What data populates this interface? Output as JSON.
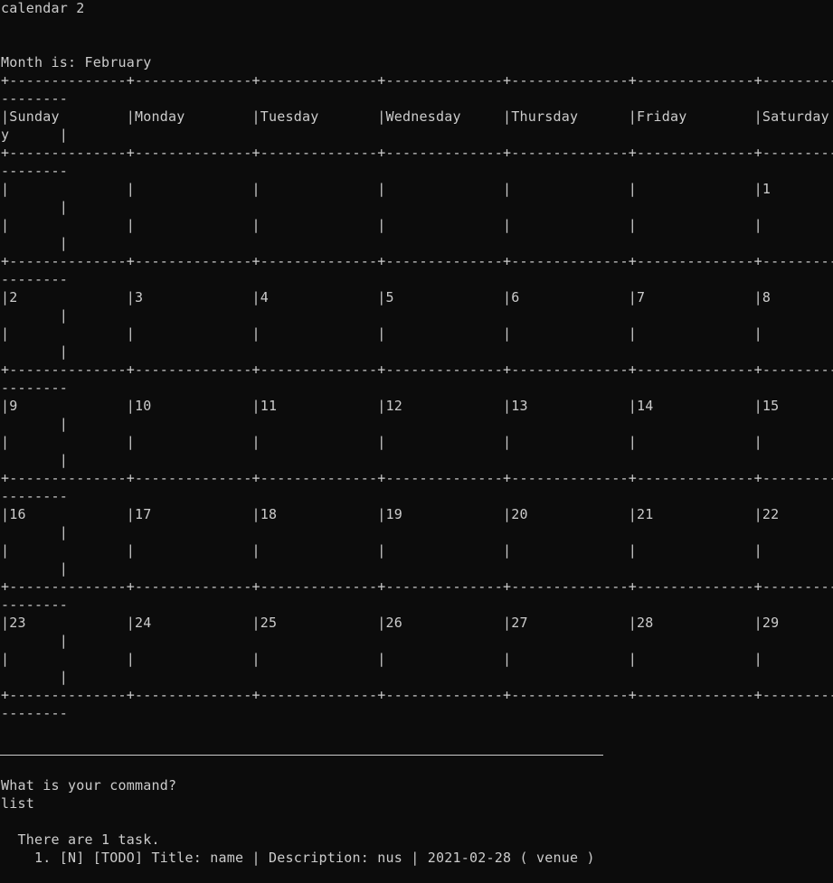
{
  "terminal": {
    "lines": [
      "calendar 2",
      "",
      "",
      "Month is: February",
      "+--------------+--------------+--------------+--------------+--------------+--------------+--------------+",
      "--------",
      "|Sunday        |Monday        |Tuesday       |Wednesday     |Thursday      |Friday        |Saturday",
      "y      |",
      "+--------------+--------------+--------------+--------------+--------------+--------------+--------------+",
      "--------",
      "|              |              |              |              |              |              |1             ",
      "       |",
      "|              |              |              |              |              |              |              ",
      "       |",
      "+--------------+--------------+--------------+--------------+--------------+--------------+--------------+",
      "--------",
      "|2             |3             |4             |5             |6             |7             |8             ",
      "       |",
      "|              |              |              |              |              |              |              ",
      "       |",
      "+--------------+--------------+--------------+--------------+--------------+--------------+--------------+",
      "--------",
      "|9             |10            |11            |12            |13            |14            |15            ",
      "       |",
      "|              |              |              |              |              |              |              ",
      "       |",
      "+--------------+--------------+--------------+--------------+--------------+--------------+--------------+",
      "--------",
      "|16            |17            |18            |19            |20            |21            |22            ",
      "       |",
      "|              |              |              |              |              |              |              ",
      "       |",
      "+--------------+--------------+--------------+--------------+--------------+--------------+--------------+",
      "--------",
      "|23            |24            |25            |26            |27            |28            |29            ",
      "       |",
      "|              |              |              |              |              |              |              ",
      "       |",
      "+--------------+--------------+--------------+--------------+--------------+--------------+--------------+",
      "--------",
      "",
      "",
      "What is your command?",
      "list",
      "",
      "  There are 1 task.",
      "    1. [N] [TODO] Title: name | Description: nus | 2021-02-28 ( venue )"
    ]
  }
}
